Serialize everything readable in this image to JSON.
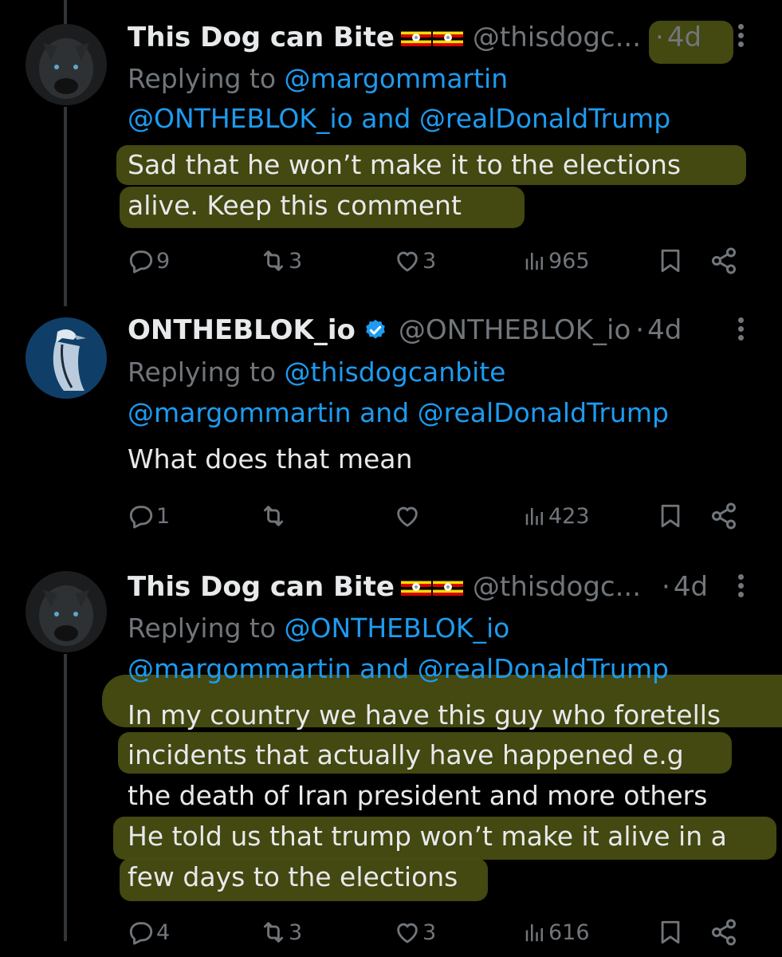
{
  "tweets": [
    {
      "name": "This Dog can Bite",
      "handle": "@thisdogc...",
      "time": "4d",
      "replying_prefix": "Replying to",
      "reply_line1": "@margommartin",
      "reply_line2": "@ONTHEBLOK_io and @realDonaldTrump",
      "body": [
        "Sad that he won’t make it to the elections",
        "alive. Keep this comment"
      ],
      "replies": "9",
      "reposts": "3",
      "likes": "3",
      "views": "965"
    },
    {
      "name": "ONTHEBLOK_io",
      "handle": "@ONTHEBLOK_io",
      "time": "4d",
      "replying_prefix": "Replying to",
      "reply_line1": "@thisdogcanbite",
      "reply_line2": "@margommartin and @realDonaldTrump",
      "body": [
        "What does that mean"
      ],
      "replies": "1",
      "reposts": "",
      "likes": "",
      "views": "423"
    },
    {
      "name": "This Dog can Bite",
      "handle": "@thisdogc...",
      "time": "4d",
      "replying_prefix": "Replying to",
      "reply_line1": "@ONTHEBLOK_io",
      "reply_line2": "@margommartin and @realDonaldTrump",
      "body": [
        "In my country we have this guy who foretells",
        "incidents that actually have happened e.g",
        "the death of Iran president and more others",
        "He told us that trump won’t make it alive in a",
        "few days to the elections"
      ],
      "replies": "4",
      "reposts": "3",
      "likes": "3",
      "views": "616"
    }
  ],
  "separator": "·",
  "colors": {
    "background": "#000000",
    "text": "#e7e9ea",
    "muted": "#71767b",
    "link": "#1d9bf0",
    "highlight": "#4a4e12",
    "verified": "#1d9bf0"
  },
  "icons": [
    "reply-icon",
    "repost-icon",
    "like-icon",
    "views-icon",
    "bookmark-icon",
    "share-icon",
    "more-icon",
    "verified-badge-icon",
    "uganda-flag-icon"
  ]
}
